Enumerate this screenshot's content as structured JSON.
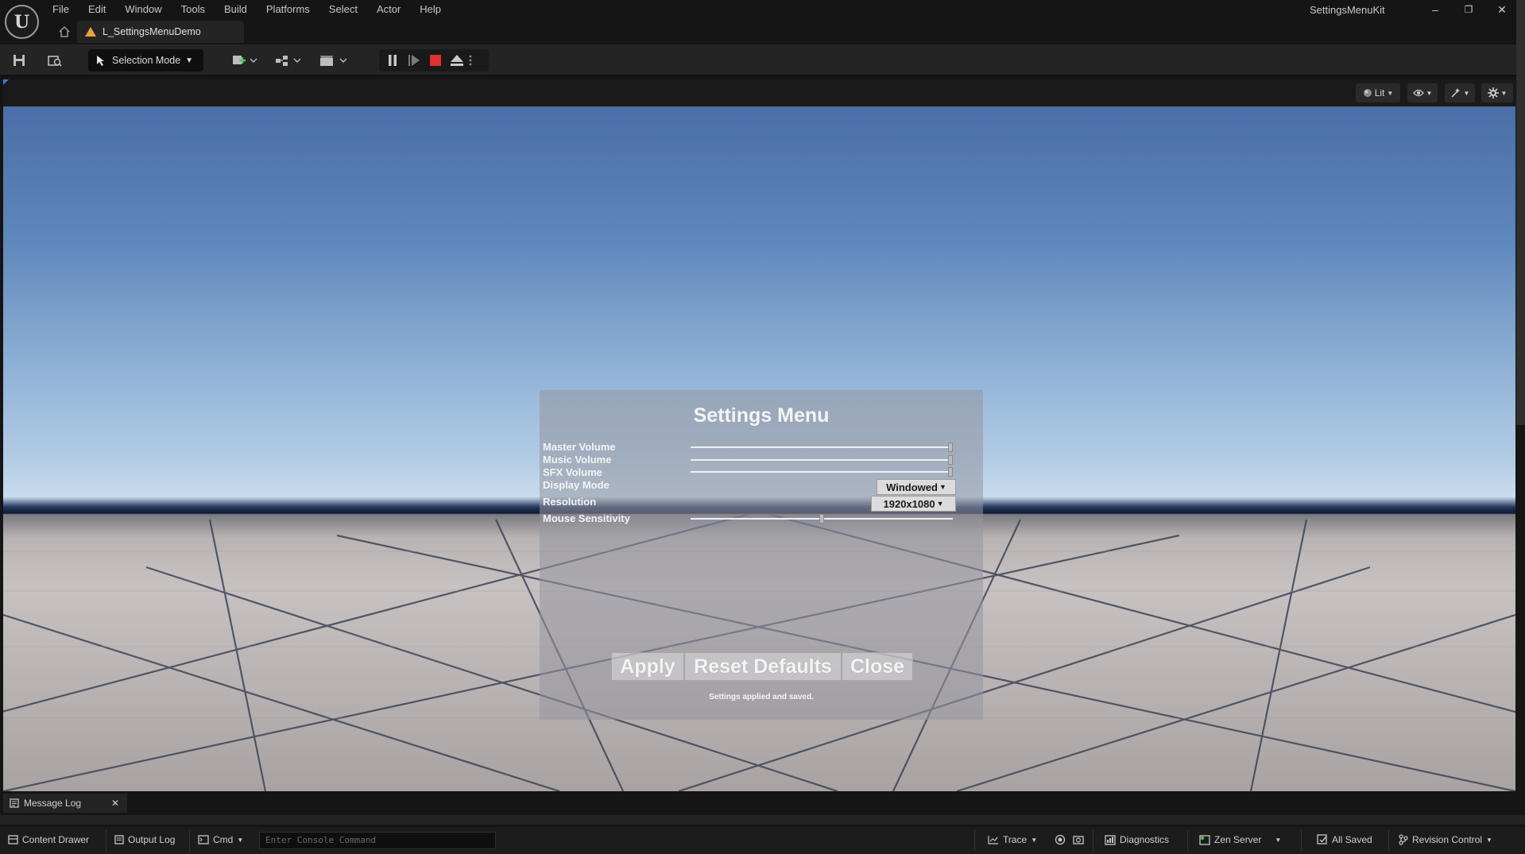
{
  "app": {
    "project_name": "SettingsMenuKit",
    "level_tab": "L_SettingsMenuDemo"
  },
  "menu": [
    "File",
    "Edit",
    "Window",
    "Tools",
    "Build",
    "Platforms",
    "Select",
    "Actor",
    "Help"
  ],
  "window_controls": {
    "minimize": "–",
    "restore": "❐",
    "close": "✕"
  },
  "toolbar": {
    "selection_mode": "Selection Mode"
  },
  "viewport": {
    "view_mode": "Lit"
  },
  "settings_menu": {
    "title": "Settings Menu",
    "rows": {
      "master_volume": {
        "label": "Master Volume",
        "level": 1.0
      },
      "music_volume": {
        "label": "Music Volume",
        "level": 1.0
      },
      "sfx_volume": {
        "label": "SFX Volume",
        "level": 1.0
      },
      "display_mode": {
        "label": "Display Mode",
        "value": "Windowed"
      },
      "resolution": {
        "label": "Resolution",
        "value": "1920x1080"
      },
      "mouse_sensitivity": {
        "label": "Mouse Sensitivity",
        "level": 0.5
      }
    },
    "buttons": {
      "apply": "Apply",
      "reset": "Reset Defaults",
      "close": "Close"
    },
    "status": "Settings applied and saved."
  },
  "bottom": {
    "message_log_tab": "Message Log",
    "close_glyph": "✕",
    "content_drawer": "Content Drawer",
    "output_log": "Output Log",
    "cmd": "Cmd",
    "console_placeholder": "Enter Console Command",
    "trace": "Trace",
    "diagnostics": "Diagnostics",
    "zen_server": "Zen Server",
    "all_saved": "All Saved",
    "revision_control": "Revision Control"
  },
  "colors": {
    "accent_red": "#e03030",
    "panel_bg": "#242424",
    "menu_bg": "#151515"
  }
}
